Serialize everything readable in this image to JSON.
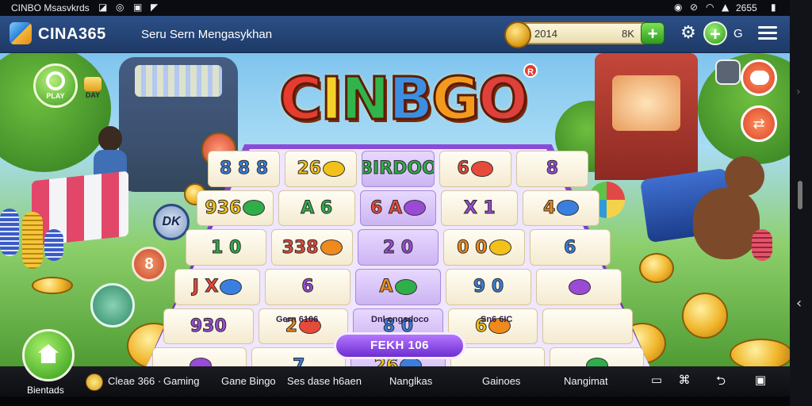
{
  "status_bar": {
    "left_text": "CINBO Msasvkrds",
    "right_text": "2655"
  },
  "header": {
    "brand": "CINA365",
    "tagline": "Seru Sern Mengasykhan",
    "balance_value": "2014",
    "balance_unit": "8K",
    "extra_label": "G"
  },
  "game": {
    "title_letters": [
      "C",
      "I",
      "N",
      "B",
      "G",
      "O"
    ],
    "reg_mark": "R",
    "gift_label": "DAY",
    "refresh_label": "PLAY",
    "dk_label": "DK",
    "eight_label": "8",
    "board": {
      "rows": [
        [
          {
            "t": "8 8 8"
          },
          {
            "t": "26"
          },
          {
            "t": "BIRDOO"
          },
          {
            "t": "6"
          },
          {
            "t": "8"
          }
        ],
        [
          {
            "t": "936"
          },
          {
            "t": "A 6"
          },
          {
            "t": "6 A"
          },
          {
            "t": "X 1"
          },
          {
            "t": "4"
          }
        ],
        [
          {
            "t": "1 0"
          },
          {
            "t": "338"
          },
          {
            "t": "2 0"
          },
          {
            "t": "0 0"
          },
          {
            "t": "6"
          }
        ],
        [
          {
            "t": "J X"
          },
          {
            "t": "6"
          },
          {
            "t": "A"
          },
          {
            "t": "9 0"
          },
          {
            "t": ""
          }
        ],
        [
          {
            "t": "930"
          },
          {
            "t": "2"
          },
          {
            "t": "8 0"
          },
          {
            "t": "6"
          },
          {
            "t": ""
          }
        ],
        [
          {
            "t": ""
          },
          {
            "t": "7"
          },
          {
            "t": "26"
          },
          {
            "t": ""
          },
          {
            "t": ""
          }
        ]
      ],
      "labels": [
        "Gern 6106",
        "Dnl cngsdoco",
        "Sn6 6IC"
      ],
      "spin_label": "FEKH 106"
    }
  },
  "bottom_bar": {
    "home_label": "Bientads",
    "items": [
      "Cleae 366 ·",
      "Gaming",
      "Gane Bingo",
      "Ses dase h6aen",
      "Nanglkas",
      "Gainoes",
      "Nangimat"
    ]
  },
  "colors": {
    "header_blue": "#2c4f86",
    "accent_green": "#3a9d1c",
    "board_purple": "#6d2ed0",
    "coin_gold": "#f0b52b"
  },
  "icons": [
    "signal-icon",
    "wifi-icon",
    "battery-icon",
    "gear-icon",
    "plus-icon",
    "menu-icon",
    "home-icon",
    "coin-icon",
    "back-icon",
    "recents-icon"
  ]
}
